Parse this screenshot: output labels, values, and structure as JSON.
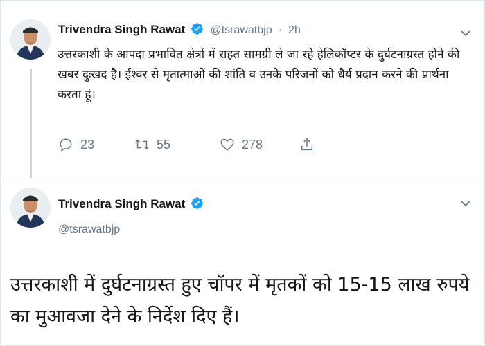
{
  "tweet1": {
    "author_name": "Trivendra Singh Rawat",
    "author_handle": "@tsrawatbjp",
    "separator": "·",
    "time": "2h",
    "text": "उत्तरकाशी के आपदा प्रभावित क्षेत्रों में राहत सामग्री ले जा रहे हेलिकॉप्टर के दुर्घटनाग्रस्त होने की खबर दुःखद है। ईश्वर से मृतात्माओं की शांति व उनके परिजनों को धैर्य प्रदान करने की प्रार्थना करता हूं।",
    "replies": "23",
    "retweets": "55",
    "likes": "278"
  },
  "tweet2": {
    "author_name": "Trivendra Singh Rawat",
    "author_handle": "@tsrawatbjp",
    "text": "उत्तरकाशी में दुर्घटनाग्रस्त हुए चॉपर में मृतकों को 15-15 लाख रुपये का मुआवजा देने के निर्देश दिए हैं।"
  },
  "icons": {
    "verified": "verified-badge-icon",
    "chevron": "chevron-down-icon",
    "reply": "reply-icon",
    "retweet": "retweet-icon",
    "like": "heart-icon",
    "share": "share-icon"
  },
  "colors": {
    "text": "#14171a",
    "secondary": "#657786",
    "verified": "#1da1f2",
    "thread_line": "#ccd6dd"
  }
}
